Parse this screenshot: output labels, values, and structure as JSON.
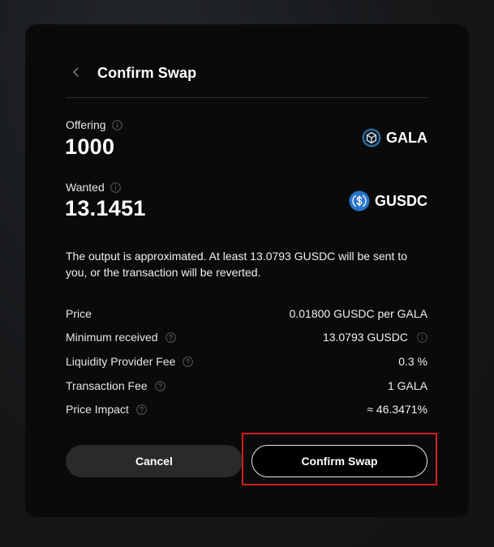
{
  "dialog": {
    "title": "Confirm Swap"
  },
  "offering": {
    "label": "Offering",
    "amount": "1000",
    "token": "GALA"
  },
  "wanted": {
    "label": "Wanted",
    "amount": "13.1451",
    "token": "GUSDC"
  },
  "notice": "The output is approximated. At least 13.0793 GUSDC will be sent to you, or the transaction will be reverted.",
  "details": [
    {
      "label": "Price",
      "value": "0.01800 GUSDC per GALA"
    },
    {
      "label": "Minimum received",
      "value": "13.0793 GUSDC"
    },
    {
      "label": "Liquidity Provider Fee",
      "value": "0.3 %"
    },
    {
      "label": "Transaction Fee",
      "value": "1 GALA"
    },
    {
      "label": "Price Impact",
      "value": "≈ 46.3471%"
    }
  ],
  "buttons": {
    "cancel": "Cancel",
    "confirm": "Confirm Swap"
  },
  "colors": {
    "modal_bg": "#0a0a0a",
    "gala_icon": "#2b6a9a",
    "gusdc_icon": "#2775ca",
    "highlight": "#d21f1f",
    "cancel_bg": "#2a2a2a"
  },
  "icons": {
    "back": "chevron-left-icon",
    "info": "info-icon",
    "help": "question-icon",
    "gala": "gala-token-icon",
    "gusdc": "gusdc-token-icon"
  }
}
